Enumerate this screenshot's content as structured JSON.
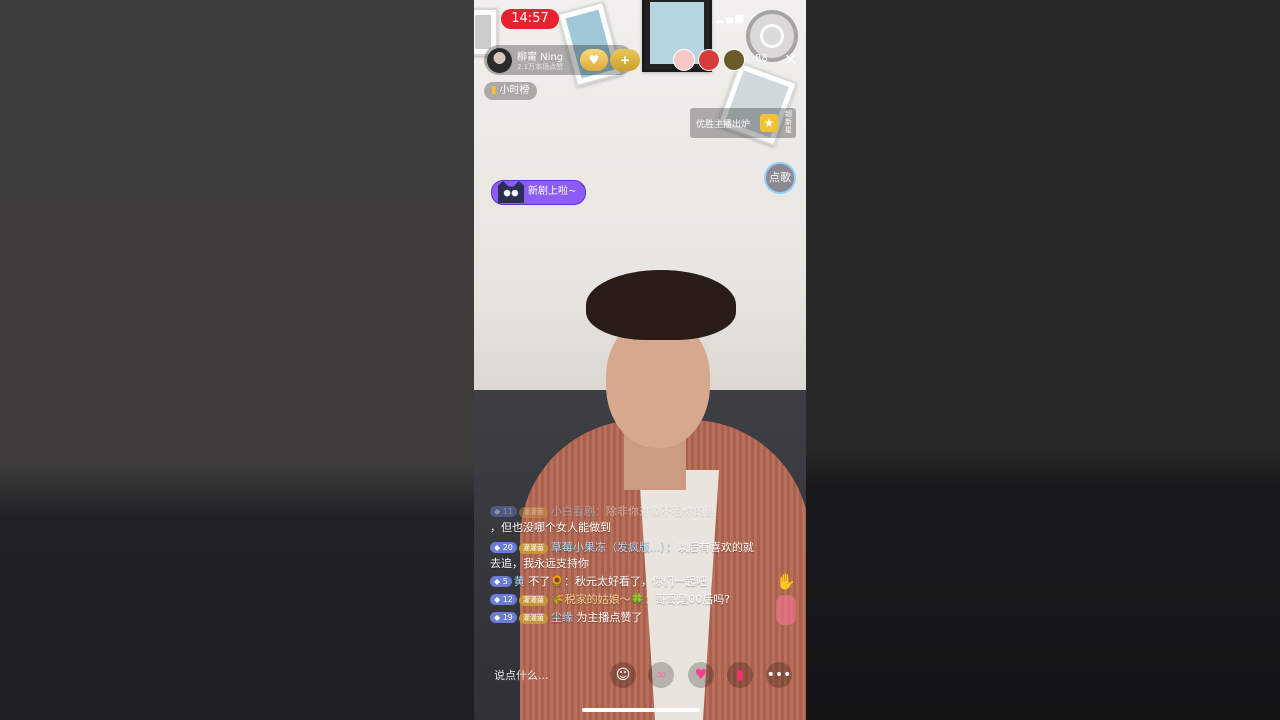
{
  "status": {
    "time": "14:57"
  },
  "streamer": {
    "name": "柳甯 Ning",
    "subtitle": "2.1万本场点赞"
  },
  "viewers": {
    "count": "88"
  },
  "rank": {
    "label": "小时榜"
  },
  "promo": {
    "text": "优胜主播出炉",
    "side": "超新星"
  },
  "song": {
    "label": "点歌"
  },
  "banner": {
    "text": "新剧上啦~"
  },
  "chat": [
    {
      "level": "11",
      "badge": "灌灌菌",
      "user": "小白看剧：",
      "text": "除非你对象不看你的剧",
      "faded": true
    },
    {
      "level": "",
      "badge": "",
      "user": "",
      "text": "，但也没哪个女人能做到",
      "faded": false
    },
    {
      "level": "20",
      "badge": "灌灌菌",
      "user": "草莓小果冻（发疯版...）：",
      "text": "以后有喜欢的就去追，我永远支持你",
      "faded": false
    },
    {
      "level": "5",
      "badge": "",
      "user": "黄",
      "text": "不了🌻：秋元太好看了，你们一起吧",
      "faded": false
    },
    {
      "level": "12",
      "badge": "灌灌菌",
      "user": "🌾税家的姑娘～🍀：",
      "text": "哥哥是00后吗?",
      "faded": false
    },
    {
      "level": "19",
      "badge": "灌灌菌",
      "user": "尘缘",
      "text": "为主播点赞了",
      "faded": false
    }
  ],
  "input": {
    "placeholder": "说点什么..."
  },
  "icons": {
    "emoji": "emoji-icon",
    "link": "link-icon",
    "gift": "gift-icon",
    "shop": "shop-icon",
    "more": "more-icon"
  },
  "colors": {
    "time_pill": "#e8202f",
    "banner": "#8b5cf6",
    "level_badge": "#6b7cd6"
  }
}
